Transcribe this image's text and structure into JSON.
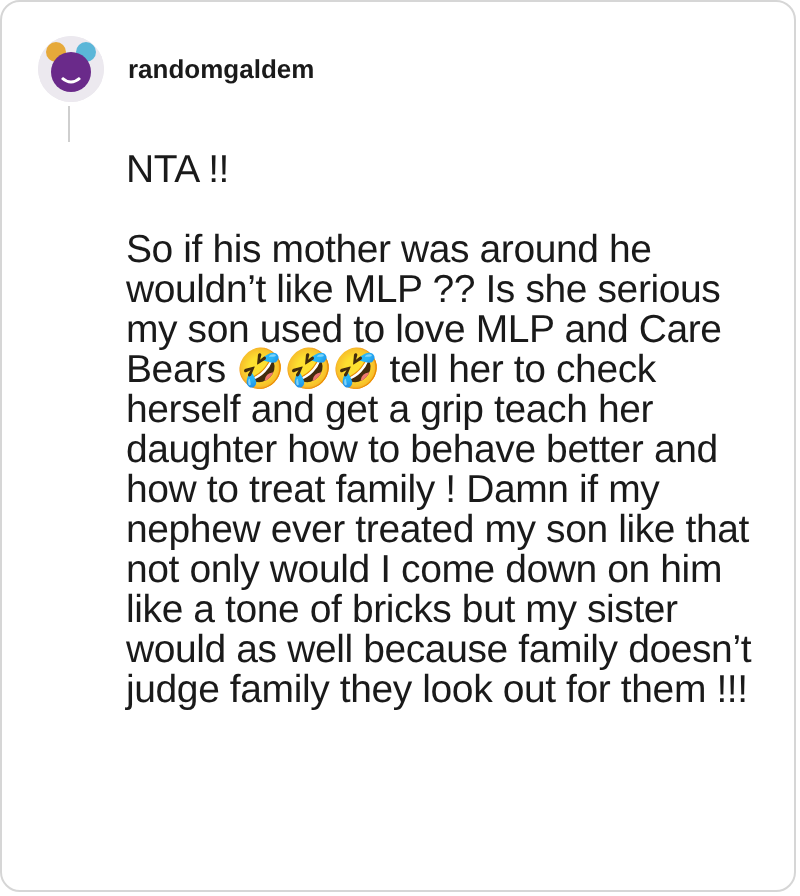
{
  "comment": {
    "username": "randomgaldem",
    "paragraphs": [
      "NTA !!",
      "So if his mother was around he wouldn’t like MLP ?? Is she serious my son used to love MLP and Care Bears 🤣🤣🤣 tell her to check herself and get a grip teach her daughter how to behave better and how to treat family ! Damn if my nephew ever treated my son like that not only would I come down on him like a tone of bricks but my sister would as well because family doesn’t judge family they look out for them !!!"
    ]
  }
}
